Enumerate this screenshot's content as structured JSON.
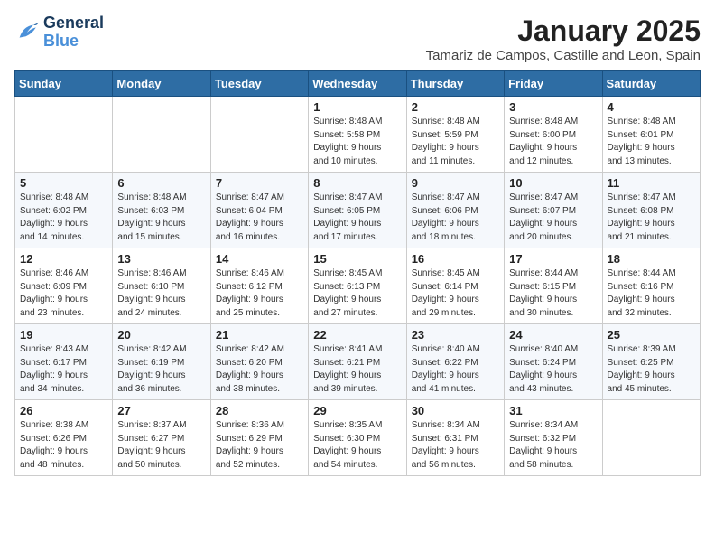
{
  "header": {
    "logo_line1": "General",
    "logo_line2": "Blue",
    "month_year": "January 2025",
    "location": "Tamariz de Campos, Castille and Leon, Spain"
  },
  "weekdays": [
    "Sunday",
    "Monday",
    "Tuesday",
    "Wednesday",
    "Thursday",
    "Friday",
    "Saturday"
  ],
  "weeks": [
    [
      {
        "day": "",
        "info": ""
      },
      {
        "day": "",
        "info": ""
      },
      {
        "day": "",
        "info": ""
      },
      {
        "day": "1",
        "info": "Sunrise: 8:48 AM\nSunset: 5:58 PM\nDaylight: 9 hours\nand 10 minutes."
      },
      {
        "day": "2",
        "info": "Sunrise: 8:48 AM\nSunset: 5:59 PM\nDaylight: 9 hours\nand 11 minutes."
      },
      {
        "day": "3",
        "info": "Sunrise: 8:48 AM\nSunset: 6:00 PM\nDaylight: 9 hours\nand 12 minutes."
      },
      {
        "day": "4",
        "info": "Sunrise: 8:48 AM\nSunset: 6:01 PM\nDaylight: 9 hours\nand 13 minutes."
      }
    ],
    [
      {
        "day": "5",
        "info": "Sunrise: 8:48 AM\nSunset: 6:02 PM\nDaylight: 9 hours\nand 14 minutes."
      },
      {
        "day": "6",
        "info": "Sunrise: 8:48 AM\nSunset: 6:03 PM\nDaylight: 9 hours\nand 15 minutes."
      },
      {
        "day": "7",
        "info": "Sunrise: 8:47 AM\nSunset: 6:04 PM\nDaylight: 9 hours\nand 16 minutes."
      },
      {
        "day": "8",
        "info": "Sunrise: 8:47 AM\nSunset: 6:05 PM\nDaylight: 9 hours\nand 17 minutes."
      },
      {
        "day": "9",
        "info": "Sunrise: 8:47 AM\nSunset: 6:06 PM\nDaylight: 9 hours\nand 18 minutes."
      },
      {
        "day": "10",
        "info": "Sunrise: 8:47 AM\nSunset: 6:07 PM\nDaylight: 9 hours\nand 20 minutes."
      },
      {
        "day": "11",
        "info": "Sunrise: 8:47 AM\nSunset: 6:08 PM\nDaylight: 9 hours\nand 21 minutes."
      }
    ],
    [
      {
        "day": "12",
        "info": "Sunrise: 8:46 AM\nSunset: 6:09 PM\nDaylight: 9 hours\nand 23 minutes."
      },
      {
        "day": "13",
        "info": "Sunrise: 8:46 AM\nSunset: 6:10 PM\nDaylight: 9 hours\nand 24 minutes."
      },
      {
        "day": "14",
        "info": "Sunrise: 8:46 AM\nSunset: 6:12 PM\nDaylight: 9 hours\nand 25 minutes."
      },
      {
        "day": "15",
        "info": "Sunrise: 8:45 AM\nSunset: 6:13 PM\nDaylight: 9 hours\nand 27 minutes."
      },
      {
        "day": "16",
        "info": "Sunrise: 8:45 AM\nSunset: 6:14 PM\nDaylight: 9 hours\nand 29 minutes."
      },
      {
        "day": "17",
        "info": "Sunrise: 8:44 AM\nSunset: 6:15 PM\nDaylight: 9 hours\nand 30 minutes."
      },
      {
        "day": "18",
        "info": "Sunrise: 8:44 AM\nSunset: 6:16 PM\nDaylight: 9 hours\nand 32 minutes."
      }
    ],
    [
      {
        "day": "19",
        "info": "Sunrise: 8:43 AM\nSunset: 6:17 PM\nDaylight: 9 hours\nand 34 minutes."
      },
      {
        "day": "20",
        "info": "Sunrise: 8:42 AM\nSunset: 6:19 PM\nDaylight: 9 hours\nand 36 minutes."
      },
      {
        "day": "21",
        "info": "Sunrise: 8:42 AM\nSunset: 6:20 PM\nDaylight: 9 hours\nand 38 minutes."
      },
      {
        "day": "22",
        "info": "Sunrise: 8:41 AM\nSunset: 6:21 PM\nDaylight: 9 hours\nand 39 minutes."
      },
      {
        "day": "23",
        "info": "Sunrise: 8:40 AM\nSunset: 6:22 PM\nDaylight: 9 hours\nand 41 minutes."
      },
      {
        "day": "24",
        "info": "Sunrise: 8:40 AM\nSunset: 6:24 PM\nDaylight: 9 hours\nand 43 minutes."
      },
      {
        "day": "25",
        "info": "Sunrise: 8:39 AM\nSunset: 6:25 PM\nDaylight: 9 hours\nand 45 minutes."
      }
    ],
    [
      {
        "day": "26",
        "info": "Sunrise: 8:38 AM\nSunset: 6:26 PM\nDaylight: 9 hours\nand 48 minutes."
      },
      {
        "day": "27",
        "info": "Sunrise: 8:37 AM\nSunset: 6:27 PM\nDaylight: 9 hours\nand 50 minutes."
      },
      {
        "day": "28",
        "info": "Sunrise: 8:36 AM\nSunset: 6:29 PM\nDaylight: 9 hours\nand 52 minutes."
      },
      {
        "day": "29",
        "info": "Sunrise: 8:35 AM\nSunset: 6:30 PM\nDaylight: 9 hours\nand 54 minutes."
      },
      {
        "day": "30",
        "info": "Sunrise: 8:34 AM\nSunset: 6:31 PM\nDaylight: 9 hours\nand 56 minutes."
      },
      {
        "day": "31",
        "info": "Sunrise: 8:34 AM\nSunset: 6:32 PM\nDaylight: 9 hours\nand 58 minutes."
      },
      {
        "day": "",
        "info": ""
      }
    ]
  ]
}
